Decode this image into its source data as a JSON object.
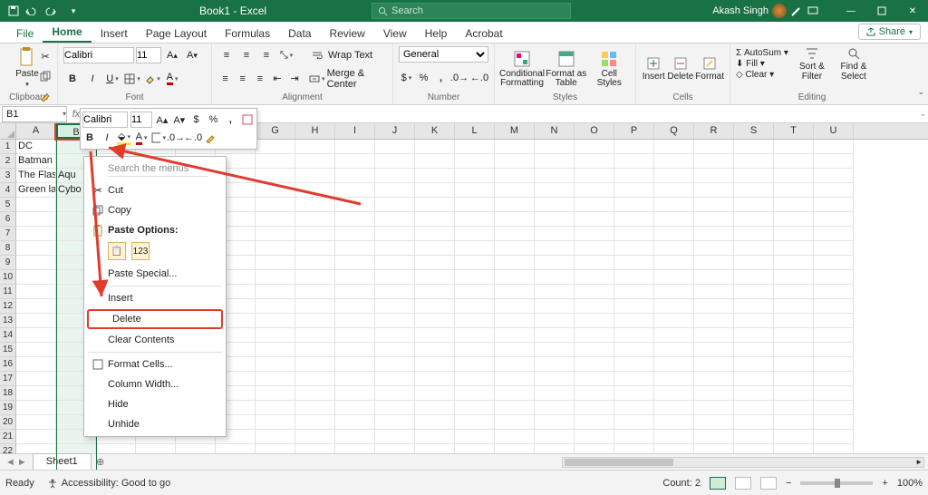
{
  "titlebar": {
    "doc_title": "Book1 - Excel",
    "search_placeholder": "Search",
    "account_name": "Akash Singh"
  },
  "tabs": {
    "file": "File",
    "home": "Home",
    "insert": "Insert",
    "page": "Page Layout",
    "formulas": "Formulas",
    "data": "Data",
    "review": "Review",
    "view": "View",
    "help": "Help",
    "acrobat": "Acrobat",
    "share": "Share"
  },
  "ribbon": {
    "clipboard": {
      "label": "Clipboard",
      "paste": "Paste"
    },
    "font": {
      "label": "Font",
      "family": "Calibri",
      "size": "11"
    },
    "alignment": {
      "label": "Alignment",
      "wrap": "Wrap Text",
      "merge": "Merge & Center"
    },
    "number": {
      "label": "Number",
      "format": "General"
    },
    "styles": {
      "label": "Styles",
      "cond": "Conditional Formatting",
      "tbl": "Format as Table",
      "cell": "Cell Styles"
    },
    "cells": {
      "label": "Cells",
      "insert": "Insert",
      "delete": "Delete",
      "format": "Format"
    },
    "editing": {
      "label": "Editing",
      "autosum": "AutoSum",
      "fill": "Fill",
      "clear": "Clear",
      "sort": "Sort & Filter",
      "find": "Find & Select"
    }
  },
  "namebox": "B1",
  "minifont": {
    "family": "Calibri",
    "size": "11"
  },
  "columns": [
    "A",
    "B",
    "C",
    "D",
    "E",
    "F",
    "G",
    "H",
    "I",
    "J",
    "K",
    "L",
    "M",
    "N",
    "O",
    "P",
    "Q",
    "R",
    "S",
    "T",
    "U"
  ],
  "grid_rows": [
    [
      "DC",
      "",
      "",
      "",
      "",
      "",
      "",
      "",
      "",
      ""
    ],
    [
      "Batman",
      "",
      "",
      "",
      "",
      "",
      "",
      "",
      "",
      ""
    ],
    [
      "The Flash",
      "Aqu",
      "",
      "",
      "",
      "",
      "",
      "",
      "",
      ""
    ],
    [
      "Green lan",
      "Cybo",
      "",
      "",
      "",
      "",
      "",
      "",
      "",
      ""
    ]
  ],
  "ctx": {
    "search_ph": "Search the menus",
    "cut": "Cut",
    "copy": "Copy",
    "paste_opt": "Paste Options:",
    "paste_special": "Paste Special...",
    "insert": "Insert",
    "delete": "Delete",
    "clear": "Clear Contents",
    "format_cells": "Format Cells...",
    "col_width": "Column Width...",
    "hide": "Hide",
    "unhide": "Unhide"
  },
  "sheet": {
    "name": "Sheet1"
  },
  "status": {
    "ready": "Ready",
    "accessibility": "Accessibility: Good to go",
    "count_label": "Count:",
    "count_value": "2",
    "zoom": "100%"
  }
}
